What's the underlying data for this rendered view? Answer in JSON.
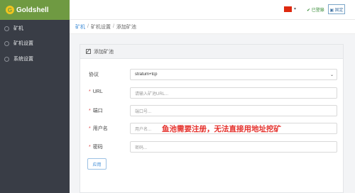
{
  "brand": {
    "name": "Goldshell",
    "logo_letter": "G"
  },
  "sidebar": {
    "items": [
      {
        "label": "矿机"
      },
      {
        "label": "矿机设置"
      },
      {
        "label": "系统设置"
      }
    ]
  },
  "header": {
    "caret": "▾",
    "login_status": "✔ 已登錄",
    "fix_button": "▣ 固定"
  },
  "breadcrumb": {
    "items": [
      "矿机",
      "矿机设置",
      "添加矿池"
    ],
    "separator": "/"
  },
  "card": {
    "title": "添加矿池",
    "fields": [
      {
        "label": "协议",
        "required": false,
        "value": "stratum+tcp",
        "type": "select"
      },
      {
        "label": "URL",
        "required": true,
        "placeholder": "请输入矿池URL..."
      },
      {
        "label": "端口",
        "required": true,
        "placeholder": "端口号..."
      },
      {
        "label": "用户名",
        "required": true,
        "placeholder": "用户名..."
      },
      {
        "label": "密码",
        "required": true,
        "placeholder": "密码..."
      }
    ],
    "required_mark": "*",
    "select_chevron": "⌄",
    "apply_label": "应用"
  },
  "annotation": {
    "text": "鱼池需要注册，无法直接用地址挖矿"
  },
  "colors": {
    "brand_green": "#6f9a42",
    "sidebar_bg": "#393d46",
    "link_blue": "#3d8bd6",
    "annotation_red": "#e5322d"
  }
}
